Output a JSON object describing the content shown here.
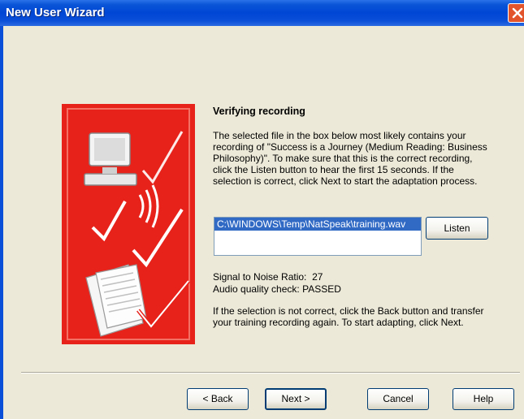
{
  "window": {
    "title": "New User Wizard"
  },
  "content": {
    "heading": "Verifying recording",
    "description": "The selected file in the box below most likely contains your recording of \"Success is a Journey (Medium Reading: Business Philosophy)\". To make sure that this is the correct recording, click the Listen button to hear the first 15 seconds. If the selection is correct, click Next to start the adaptation process.",
    "file_list": [
      "C:\\WINDOWS\\Temp\\NatSpeak\\training.wav"
    ],
    "listen_label": "Listen",
    "snr_label": "Signal to Noise Ratio:",
    "snr_value": "27",
    "audio_check_label": "Audio quality check:",
    "audio_check_value": "PASSED",
    "footer_text": "If the selection is not correct, click the Back button and transfer your training recording again. To start adapting, click Next."
  },
  "buttons": {
    "back": "< Back",
    "next": "Next >",
    "cancel": "Cancel",
    "help": "Help"
  },
  "colors": {
    "title_bar": "#0a4fd8",
    "art_background": "#e6221b",
    "selection": "#316ac5",
    "dialog_face": "#ece9d8"
  },
  "icons": {
    "close": "close-icon",
    "art": "wizard-illustration"
  }
}
